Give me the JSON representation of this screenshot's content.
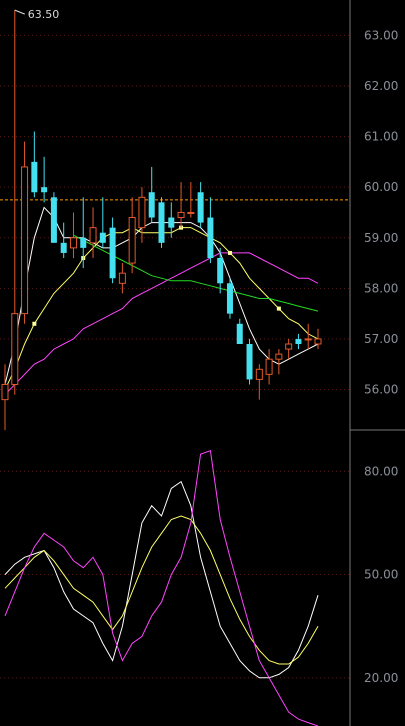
{
  "colors": {
    "background": "#000000",
    "up": "#e25a2a",
    "down": "#45e0f0",
    "ma5": "#ffffff",
    "ma10": "#ffff66",
    "ma20": "#ff44ff",
    "ma60": "#22dd22",
    "ref_line": "#ff9900",
    "grid": "#5a1a1a",
    "axis_text": "#8a8f98"
  },
  "chart_data": [
    {
      "type": "candlestick",
      "panel": "price",
      "ylim": [
        55.2,
        63.7
      ],
      "y_ticks": [
        "63.00",
        "62.00",
        "61.00",
        "60.00",
        "59.00",
        "58.00",
        "57.00",
        "56.00"
      ],
      "high_annotation": "63.50",
      "reference_line": 59.75,
      "candles": [
        {
          "o": 55.8,
          "h": 56.5,
          "l": 55.2,
          "c": 56.1
        },
        {
          "o": 56.1,
          "h": 63.5,
          "l": 55.9,
          "c": 57.5
        },
        {
          "o": 57.5,
          "h": 60.9,
          "l": 57.3,
          "c": 60.4
        },
        {
          "o": 60.5,
          "h": 61.1,
          "l": 59.8,
          "c": 59.9
        },
        {
          "o": 60.0,
          "h": 60.6,
          "l": 59.7,
          "c": 59.9
        },
        {
          "o": 59.8,
          "h": 59.9,
          "l": 58.9,
          "c": 58.9
        },
        {
          "o": 58.9,
          "h": 59.3,
          "l": 58.6,
          "c": 58.7
        },
        {
          "o": 58.8,
          "h": 59.5,
          "l": 58.6,
          "c": 59.0
        },
        {
          "o": 59.0,
          "h": 59.8,
          "l": 58.4,
          "c": 58.8
        },
        {
          "o": 58.9,
          "h": 59.6,
          "l": 58.6,
          "c": 59.2
        },
        {
          "o": 59.1,
          "h": 59.8,
          "l": 58.8,
          "c": 58.9
        },
        {
          "o": 59.2,
          "h": 59.4,
          "l": 58.1,
          "c": 58.2
        },
        {
          "o": 58.1,
          "h": 58.5,
          "l": 57.9,
          "c": 58.3
        },
        {
          "o": 58.5,
          "h": 59.8,
          "l": 58.3,
          "c": 59.4
        },
        {
          "o": 59.2,
          "h": 60.0,
          "l": 58.9,
          "c": 59.8
        },
        {
          "o": 59.9,
          "h": 60.4,
          "l": 59.3,
          "c": 59.4
        },
        {
          "o": 59.7,
          "h": 59.8,
          "l": 58.8,
          "c": 58.9
        },
        {
          "o": 59.4,
          "h": 59.7,
          "l": 59.0,
          "c": 59.2
        },
        {
          "o": 59.4,
          "h": 60.1,
          "l": 59.2,
          "c": 59.5
        },
        {
          "o": 59.5,
          "h": 60.1,
          "l": 59.4,
          "c": 59.5
        },
        {
          "o": 59.9,
          "h": 60.1,
          "l": 59.2,
          "c": 59.3
        },
        {
          "o": 59.4,
          "h": 59.8,
          "l": 58.5,
          "c": 58.6
        },
        {
          "o": 58.6,
          "h": 58.8,
          "l": 57.9,
          "c": 58.1
        },
        {
          "o": 58.1,
          "h": 58.2,
          "l": 57.4,
          "c": 57.5
        },
        {
          "o": 57.3,
          "h": 57.4,
          "l": 56.9,
          "c": 56.9
        },
        {
          "o": 56.9,
          "h": 57.0,
          "l": 56.1,
          "c": 56.2
        },
        {
          "o": 56.2,
          "h": 56.5,
          "l": 55.8,
          "c": 56.4
        },
        {
          "o": 56.3,
          "h": 56.8,
          "l": 56.1,
          "c": 56.6
        },
        {
          "o": 56.6,
          "h": 56.8,
          "l": 56.3,
          "c": 56.7
        },
        {
          "o": 56.8,
          "h": 57.0,
          "l": 56.6,
          "c": 56.9
        },
        {
          "o": 57.0,
          "h": 57.1,
          "l": 56.8,
          "c": 56.9
        },
        {
          "o": 57.0,
          "h": 57.3,
          "l": 56.8,
          "c": 57.0
        },
        {
          "o": 56.9,
          "h": 57.2,
          "l": 56.8,
          "c": 57.0
        }
      ],
      "ma_lines": [
        {
          "key": "ma5",
          "values": [
            56.1,
            56.9,
            58.0,
            59.0,
            59.6,
            59.4,
            59.0,
            59.0,
            59.0,
            58.9,
            58.8,
            58.8,
            58.9,
            59.0,
            59.2,
            59.3,
            59.3,
            59.3,
            59.3,
            59.3,
            59.2,
            59.0,
            58.7,
            58.2,
            57.7,
            57.2,
            56.8,
            56.6,
            56.5,
            56.6,
            56.7,
            56.8,
            56.9
          ]
        },
        {
          "key": "ma10",
          "values": [
            56.0,
            56.4,
            56.9,
            57.3,
            57.6,
            57.9,
            58.1,
            58.3,
            58.6,
            58.8,
            59.0,
            59.1,
            59.1,
            59.2,
            59.1,
            59.1,
            59.1,
            59.1,
            59.2,
            59.2,
            59.1,
            59.0,
            58.9,
            58.7,
            58.5,
            58.2,
            58.0,
            57.8,
            57.6,
            57.4,
            57.3,
            57.1,
            57.0
          ]
        },
        {
          "key": "ma20",
          "values": [
            55.9,
            56.1,
            56.3,
            56.5,
            56.6,
            56.8,
            56.9,
            57.0,
            57.2,
            57.3,
            57.4,
            57.5,
            57.6,
            57.8,
            57.9,
            58.0,
            58.1,
            58.2,
            58.3,
            58.4,
            58.5,
            58.6,
            58.7,
            58.7,
            58.7,
            58.7,
            58.6,
            58.5,
            58.4,
            58.3,
            58.2,
            58.2,
            58.1
          ]
        },
        {
          "key": "ma60",
          "values": [
            null,
            null,
            null,
            null,
            null,
            null,
            null,
            59.05,
            58.95,
            58.85,
            58.75,
            58.65,
            58.55,
            58.45,
            58.35,
            58.25,
            58.2,
            58.15,
            58.15,
            58.15,
            58.1,
            58.05,
            58.0,
            57.95,
            57.9,
            57.85,
            57.8,
            57.8,
            57.75,
            57.7,
            57.65,
            57.6,
            57.55
          ]
        }
      ]
    },
    {
      "type": "line",
      "panel": "indicator",
      "ylim": [
        6,
        92
      ],
      "y_ticks": [
        "80.00",
        "50.00",
        "20.00"
      ],
      "series": [
        {
          "key": "ma5",
          "values": [
            50,
            53,
            55,
            56,
            57,
            52,
            45,
            40,
            38,
            36,
            30,
            25,
            35,
            50,
            65,
            70,
            67,
            75,
            77,
            70,
            55,
            45,
            35,
            30,
            25,
            22,
            20,
            20,
            21,
            23,
            28,
            35,
            44
          ]
        },
        {
          "key": "ma10",
          "values": [
            46,
            49,
            52,
            55,
            57,
            54,
            50,
            46,
            44,
            42,
            38,
            34,
            38,
            45,
            52,
            58,
            62,
            66,
            67,
            66,
            62,
            57,
            50,
            43,
            37,
            32,
            28,
            25,
            24,
            24,
            26,
            30,
            35
          ]
        },
        {
          "key": "ma20",
          "values": [
            38,
            45,
            52,
            58,
            62,
            60,
            58,
            54,
            52,
            55,
            50,
            33,
            25,
            30,
            32,
            38,
            42,
            50,
            55,
            65,
            85,
            86,
            66,
            55,
            45,
            35,
            25,
            20,
            15,
            10,
            8,
            7,
            6
          ]
        }
      ]
    }
  ]
}
